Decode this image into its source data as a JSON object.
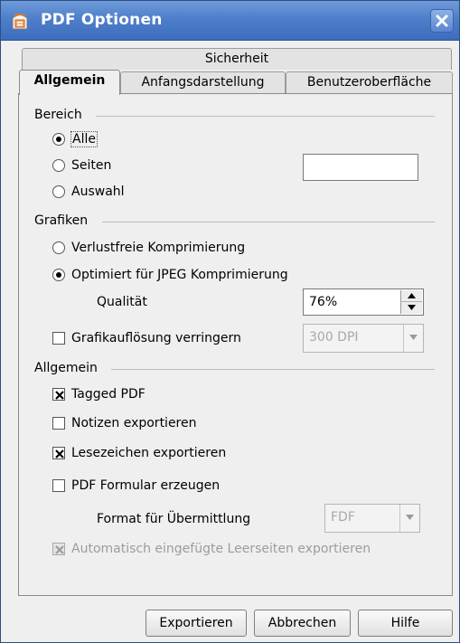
{
  "window": {
    "title": "PDF Optionen",
    "app_icon": "openoffice-icon",
    "close_icon": "close-icon"
  },
  "tabs": {
    "back_row": [
      "Sicherheit"
    ],
    "front_row": [
      "Allgemein",
      "Anfangsdarstellung",
      "Benutzeroberfläche"
    ],
    "active": "Allgemein"
  },
  "bereich": {
    "heading": "Bereich",
    "alle_label": "Alle",
    "seiten_label": "Seiten",
    "auswahl_label": "Auswahl",
    "selected": "Alle",
    "seiten_value": ""
  },
  "grafiken": {
    "heading": "Grafiken",
    "verlustfrei_label": "Verlustfreie Komprimierung",
    "jpeg_label": "Optimiert für JPEG Komprimierung",
    "selected": "Optimiert für JPEG Komprimierung",
    "qualitaet_label": "Qualität",
    "qualitaet_value": "76%",
    "aufloesung_label": "Grafikauflösung verringern",
    "aufloesung_checked": false,
    "aufloesung_value": "300 DPI"
  },
  "allgemein": {
    "heading": "Allgemein",
    "tagged_label": "Tagged PDF",
    "tagged_checked": true,
    "notizen_label": "Notizen exportieren",
    "notizen_checked": false,
    "lesezeichen_label": "Lesezeichen exportieren",
    "lesezeichen_checked": true,
    "formular_label": "PDF Formular erzeugen",
    "formular_checked": false,
    "format_label": "Format für Übermittlung",
    "format_value": "FDF",
    "leerseiten_label": "Automatisch eingefügte Leerseiten exportieren",
    "leerseiten_checked": true
  },
  "buttons": {
    "export": "Exportieren",
    "cancel": "Abbrechen",
    "help": "Hilfe"
  }
}
